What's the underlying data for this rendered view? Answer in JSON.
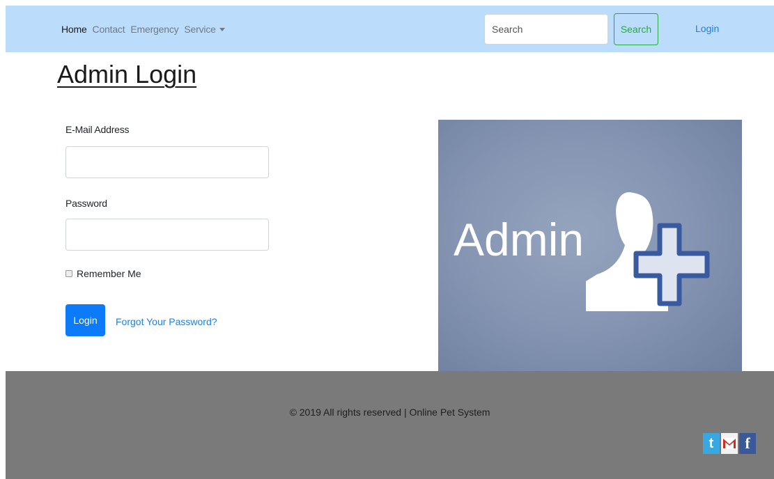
{
  "nav": {
    "links": [
      {
        "label": "Home"
      },
      {
        "label": "Contact"
      },
      {
        "label": "Emergency"
      },
      {
        "label": "Service"
      }
    ],
    "search_placeholder": "Search",
    "search_button": "Search",
    "login": "Login"
  },
  "page": {
    "title": "Admin Login"
  },
  "form": {
    "email_label": "E-Mail Address",
    "email_value": "",
    "password_label": "Password",
    "password_value": "",
    "remember_label": "Remember Me",
    "remember_checked": false,
    "login_button": "Login",
    "forgot_link": "Forgot Your Password?"
  },
  "hero_image": {
    "text": "Admin"
  },
  "footer": {
    "copyright": "© 2019 All rights reserved | Online Pet System",
    "social": [
      {
        "icon": "twitter-icon",
        "glyph": "t"
      },
      {
        "icon": "gmail-icon",
        "glyph": "M"
      },
      {
        "icon": "facebook-icon",
        "glyph": "f"
      }
    ]
  },
  "colors": {
    "navbar": "#bcdcfb",
    "primary": "#0d7bf7",
    "success": "#28a745",
    "footer": "#7a7a7a"
  }
}
